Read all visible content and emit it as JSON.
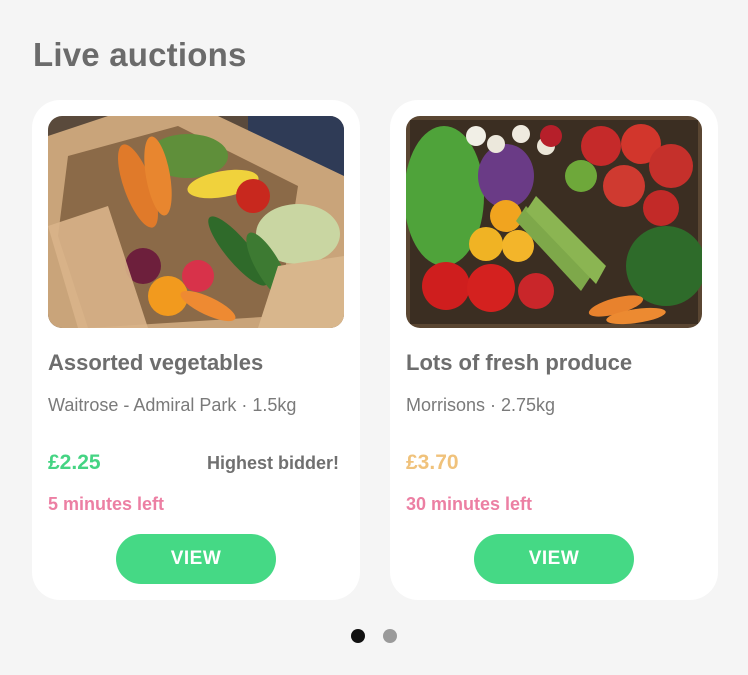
{
  "section": {
    "title": "Live auctions"
  },
  "auctions": [
    {
      "image_name": "vegetable-box-photo",
      "title": "Assorted vegetables",
      "store": "Waitrose - Admiral Park · 1.5kg",
      "price": "£2.25",
      "price_color": "#45d483",
      "status": "Highest bidder!",
      "time_left": "5 minutes left",
      "button_label": "VIEW"
    },
    {
      "image_name": "fresh-produce-crate-photo",
      "title": "Lots of fresh produce",
      "store": "Morrisons · 2.75kg",
      "price": "£3.70",
      "price_color": "#f0c27b",
      "status": "",
      "time_left": "30 minutes left",
      "button_label": "VIEW"
    }
  ],
  "pagination": {
    "total": 2,
    "active_index": 0
  },
  "colors": {
    "accent_green": "#45d985",
    "time_pink": "#ec7fa3",
    "background": "#f5f5f5"
  }
}
